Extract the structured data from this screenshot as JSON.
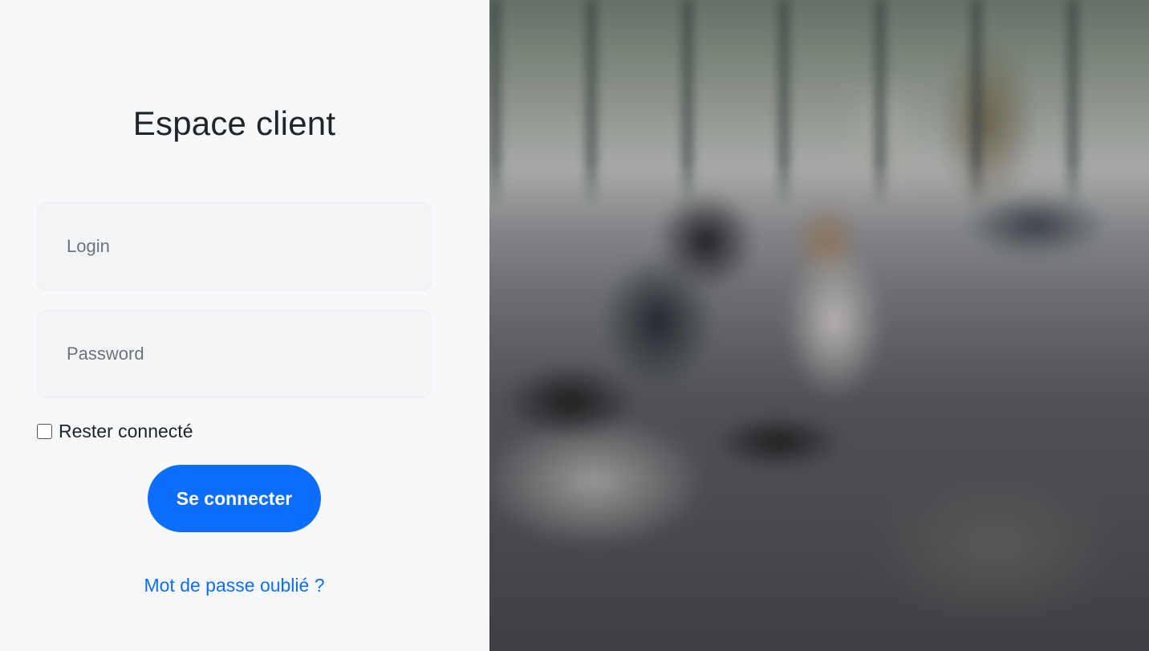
{
  "login": {
    "title": "Espace client",
    "login_placeholder": "Login",
    "password_placeholder": "Password",
    "remember_label": "Rester connecté",
    "remember_checked": false,
    "submit_label": "Se connecter",
    "forgot_label": "Mot de passe oublié ?"
  },
  "colors": {
    "accent": "#0d6efd",
    "panel_background": "#f7f8fa",
    "field_background": "#f3f4f6",
    "text": "#212529"
  },
  "image_panel": {
    "icon": "office-photo"
  }
}
